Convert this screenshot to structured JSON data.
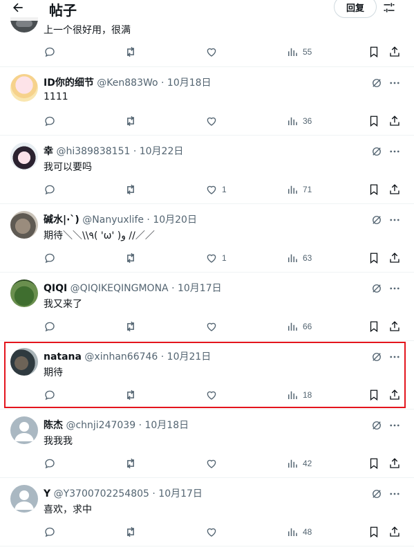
{
  "header": {
    "title": "帖子",
    "reply_button": "回复"
  },
  "partial_post": {
    "content": "上一个很好用，很满",
    "actions": {
      "reply": "",
      "repost": "",
      "like": "",
      "views": "55"
    }
  },
  "posts": [
    {
      "name": "ID你的细节",
      "meta": " @Ken883Wo · 10月18日",
      "content": "1111",
      "likes": "",
      "views": "36"
    },
    {
      "name": "幸",
      "meta": " @hi389838151 · 10月22日",
      "content": "我可以要吗",
      "likes": "1",
      "views": "71"
    },
    {
      "name": "碱水|·`)",
      "meta": " @Nanyuxlife · 10月20日",
      "content": "期待＼＼\\\\٩( 'ω' )و //／／",
      "likes": "1",
      "views": "63"
    },
    {
      "name": "QIQI",
      "meta": " @QIQIKEQINGMONA · 10月17日",
      "content": "我又来了",
      "likes": "",
      "views": "66"
    },
    {
      "name": "natana",
      "meta": " @xinhan66746 · 10月21日",
      "content": "期待",
      "likes": "",
      "views": "18"
    },
    {
      "name": "陈杰",
      "meta": " @chnji247039 · 10月18日",
      "content": "我我我",
      "likes": "",
      "views": "42"
    },
    {
      "name": "Y",
      "meta": " @Y3700702254805 · 10月17日",
      "content": "喜欢，求中",
      "likes": "",
      "views": "48"
    }
  ],
  "colors": {
    "text": "#0f1419",
    "secondary": "#536471",
    "divider": "#eff3f4",
    "highlight": "#e3141c"
  }
}
